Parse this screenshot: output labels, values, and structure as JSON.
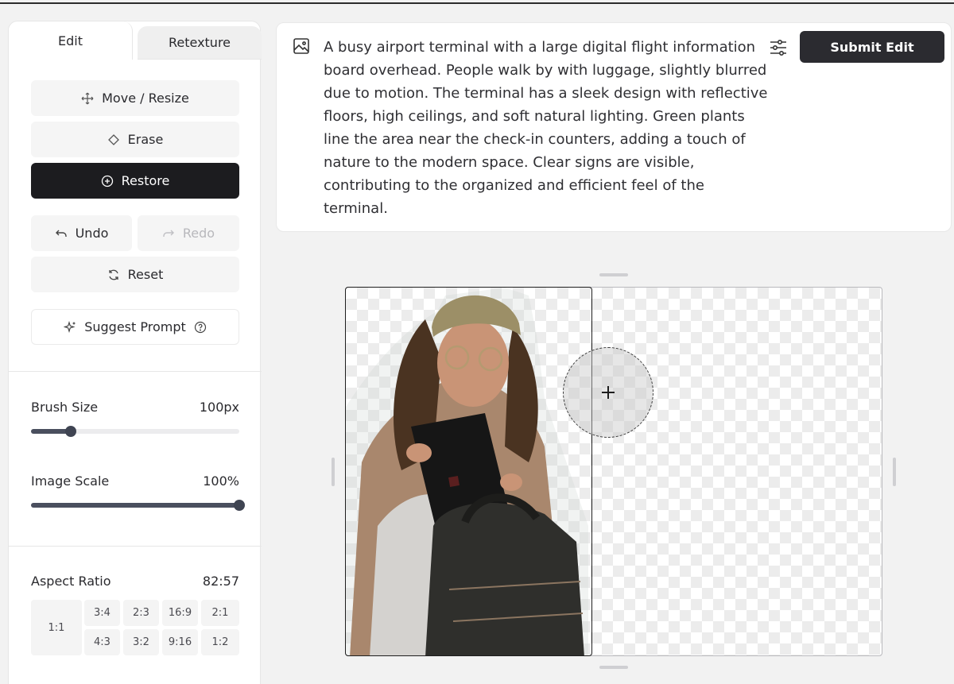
{
  "tabs": {
    "edit": "Edit",
    "retexture": "Retexture"
  },
  "tools": {
    "move_resize": "Move / Resize",
    "erase": "Erase",
    "restore": "Restore",
    "undo": "Undo",
    "redo": "Redo",
    "reset": "Reset",
    "suggest_prompt": "Suggest Prompt"
  },
  "brush_size": {
    "label": "Brush Size",
    "value": "100px",
    "fraction": 0.19
  },
  "image_scale": {
    "label": "Image Scale",
    "value": "100%",
    "fraction": 1.0
  },
  "aspect_ratio": {
    "label": "Aspect Ratio",
    "value": "82:57",
    "options": [
      "1:1",
      "3:4",
      "2:3",
      "16:9",
      "2:1",
      "4:3",
      "3:2",
      "9:16",
      "1:2"
    ]
  },
  "prompt": {
    "text": "A busy airport terminal with a large digital flight information board overhead. People walk by with luggage, slightly blurred due to motion. The terminal has a sleek design with reflective floors, high ceilings, and soft natural lighting. Green plants line the area near the check-in counters, adding a touch of nature to the modern space. Clear signs are visible, contributing to the organized and efficient feel of the terminal.",
    "submit_label": "Submit Edit"
  },
  "colors": {
    "accent_dark": "#1c1c1f",
    "submit_bg": "#2b2b30",
    "panel_bg": "#ffffff",
    "app_bg": "#f2f2f2"
  },
  "icons": {
    "move": "move-arrows-icon",
    "erase": "eraser-icon",
    "restore": "plus-circle-icon",
    "undo": "undo-arrow-icon",
    "redo": "redo-arrow-icon",
    "reset": "refresh-icon",
    "suggest": "sparkles-icon",
    "help": "help-circle-icon",
    "prompt": "image-icon",
    "settings": "sliders-icon",
    "brush": "crosshair-plus-icon"
  }
}
